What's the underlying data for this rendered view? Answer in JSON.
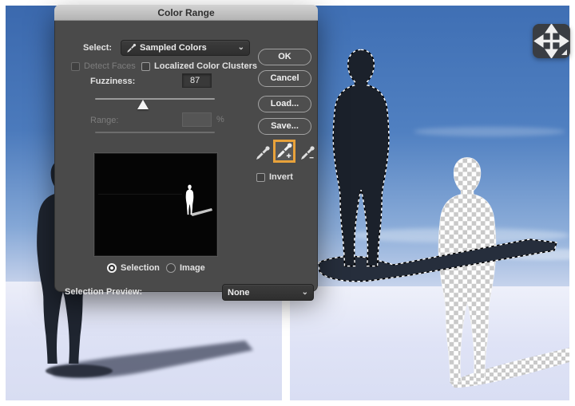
{
  "window": {
    "title": "Color Range"
  },
  "select_row": {
    "label": "Select:",
    "value": "Sampled Colors"
  },
  "checkboxes": {
    "detect_faces": "Detect Faces",
    "localized": "Localized Color Clusters",
    "invert": "Invert"
  },
  "fuzziness": {
    "label": "Fuzziness:",
    "value": "87"
  },
  "range": {
    "label": "Range:",
    "value": "",
    "unit": "%"
  },
  "preview_toggle": {
    "selection": "Selection",
    "image": "Image"
  },
  "selection_preview": {
    "label": "Selection Preview:",
    "value": "None"
  },
  "buttons": {
    "ok": "OK",
    "cancel": "Cancel",
    "load": "Load...",
    "save": "Save..."
  },
  "icons": {
    "chevron_down": "⌄",
    "select_value_icon": "eyedropper",
    "dropper_sample": "eyedropper",
    "dropper_add": "eyedropper-plus",
    "dropper_subtract": "eyedropper-minus",
    "move_tool": "move-arrows"
  },
  "colors": {
    "highlight_box": "#e8a23b",
    "dialog_bg": "#4a4a4a",
    "titlebar": "#c4c4c4",
    "sky_top": "#3b69ae",
    "sky_horizon": "#bac9e7",
    "ground": "#dde1f4",
    "silhouette": "#1e2430"
  }
}
